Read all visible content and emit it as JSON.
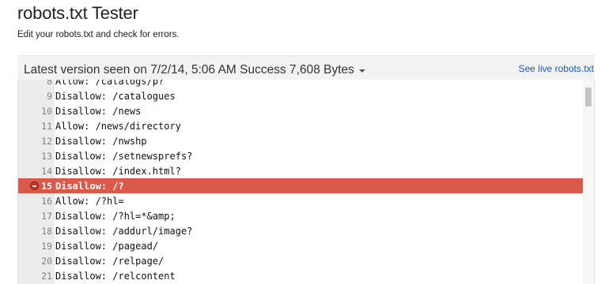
{
  "page": {
    "title": "robots.txt Tester",
    "subtitle": "Edit your robots.txt and check for errors."
  },
  "version_bar": {
    "label": "Latest version seen on 7/2/14, 5:06 AM Success 7,608 Bytes",
    "live_link": "See live robots.txt"
  },
  "editor": {
    "lines": [
      {
        "num": "8",
        "text": "Allow: /catalogs/p?"
      },
      {
        "num": "9",
        "text": "Disallow: /catalogues"
      },
      {
        "num": "10",
        "text": "Disallow: /news"
      },
      {
        "num": "11",
        "text": "Allow: /news/directory"
      },
      {
        "num": "12",
        "text": "Disallow: /nwshp"
      },
      {
        "num": "13",
        "text": "Disallow: /setnewsprefs?"
      },
      {
        "num": "14",
        "text": "Disallow: /index.html?"
      },
      {
        "num": "15",
        "text": "Disallow: /?",
        "error": true
      },
      {
        "num": "16",
        "text": "Allow: /?hl="
      },
      {
        "num": "17",
        "text": "Disallow: /?hl=*&amp;"
      },
      {
        "num": "18",
        "text": "Disallow: /addurl/image?"
      },
      {
        "num": "19",
        "text": "Disallow: /pagead/"
      },
      {
        "num": "20",
        "text": "Disallow: /relpage/"
      },
      {
        "num": "21",
        "text": "Disallow: /relcontent"
      }
    ],
    "error_color": "#d9594b",
    "error_icon": "minus-circle-icon"
  },
  "colors": {
    "link": "#1a55c8",
    "gutter": "#ececec",
    "header_bar": "#f3f3f3"
  }
}
